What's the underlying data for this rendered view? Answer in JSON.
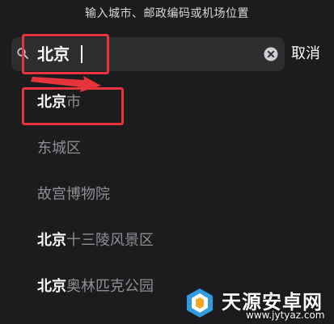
{
  "header": {
    "prompt": "输入城市、邮政编码或机场位置"
  },
  "search": {
    "query": "北京",
    "cancel_label": "取消"
  },
  "results": [
    {
      "match": "北京",
      "rest": "市"
    },
    {
      "match": "",
      "rest": "东城区"
    },
    {
      "match": "",
      "rest": "故宫博物院"
    },
    {
      "match": "北京",
      "rest": "十三陵风景区"
    },
    {
      "match": "北京",
      "rest": "奥林匹克公园"
    }
  ],
  "watermark": {
    "title": "天源安卓网",
    "url": "www.jytyaz.com"
  },
  "colors": {
    "background": "#1c1c1e",
    "search_field": "#2e2e31",
    "match_text": "#ffffff",
    "secondary_text": "#8e8e93",
    "annotation": "#e5343c"
  },
  "icons": {
    "search": "search-icon",
    "clear": "clear-icon"
  }
}
